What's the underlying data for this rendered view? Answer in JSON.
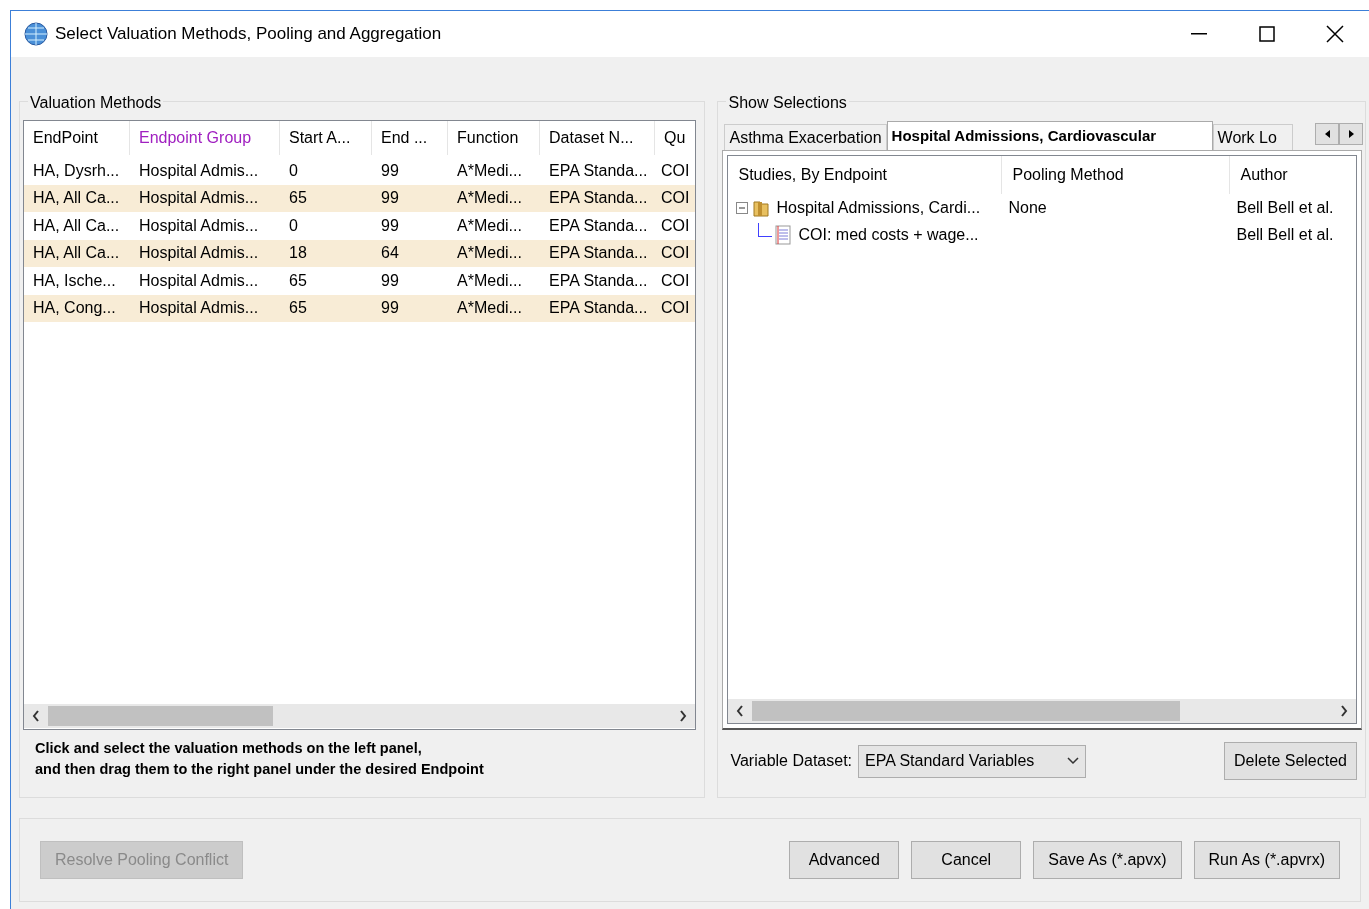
{
  "window": {
    "title": "Select Valuation Methods, Pooling and Aggregation"
  },
  "valuation_methods": {
    "title": "Valuation Methods",
    "columns": [
      {
        "label": "EndPoint",
        "highlighted": false
      },
      {
        "label": "Endpoint Group",
        "highlighted": true
      },
      {
        "label": "Start A...",
        "highlighted": false
      },
      {
        "label": "End ...",
        "highlighted": false
      },
      {
        "label": "Function",
        "highlighted": false
      },
      {
        "label": "Dataset N...",
        "highlighted": false
      },
      {
        "label": "Qu",
        "highlighted": false
      }
    ],
    "rows": [
      [
        "HA, Dysrh...",
        "Hospital Admis...",
        "0",
        "99",
        "A*Medi...",
        "EPA Standa...",
        "COI"
      ],
      [
        "HA, All Ca...",
        "Hospital Admis...",
        "65",
        "99",
        "A*Medi...",
        "EPA Standa...",
        "COI"
      ],
      [
        "HA, All Ca...",
        "Hospital Admis...",
        "0",
        "99",
        "A*Medi...",
        "EPA Standa...",
        "COI"
      ],
      [
        "HA, All Ca...",
        "Hospital Admis...",
        "18",
        "64",
        "A*Medi...",
        "EPA Standa...",
        "COI"
      ],
      [
        "HA, Ische...",
        "Hospital Admis...",
        "65",
        "99",
        "A*Medi...",
        "EPA Standa...",
        "COI"
      ],
      [
        "HA, Cong...",
        "Hospital Admis...",
        "65",
        "99",
        "A*Medi...",
        "EPA Standa...",
        "COI"
      ]
    ],
    "instructions": [
      "Click and select the valuation methods on the left panel,",
      "and then drag them to the right panel under the desired Endpoint"
    ]
  },
  "show_selections": {
    "title": "Show Selections",
    "tabs": [
      {
        "label": "Asthma Exacerbation",
        "selected": false
      },
      {
        "label": "Hospital Admissions, Cardiovascular",
        "selected": true
      },
      {
        "label": "Work Lo",
        "selected": false
      }
    ],
    "columns": [
      "Studies, By Endpoint",
      "Pooling Method",
      "Author"
    ],
    "tree": [
      {
        "kind": "folder",
        "label": "Hospital Admissions, Cardi...",
        "pooling": "None",
        "author": "Bell Bell et al.",
        "expanded": true,
        "children": [
          {
            "kind": "document",
            "label": "COI: med costs + wage...",
            "author": "Bell Bell et al."
          }
        ]
      }
    ],
    "variable_dataset": {
      "label": "Variable Dataset:",
      "value": "EPA Standard Variables"
    },
    "delete_button": "Delete Selected"
  },
  "footer": {
    "buttons": [
      {
        "label": "Resolve Pooling Conflict",
        "disabled": true
      },
      {
        "label": "Advanced",
        "disabled": false
      },
      {
        "label": "Cancel",
        "disabled": false
      },
      {
        "label": "Save As (*.apvx)",
        "disabled": false
      },
      {
        "label": "Run As (*.apvrx)",
        "disabled": false
      }
    ]
  }
}
